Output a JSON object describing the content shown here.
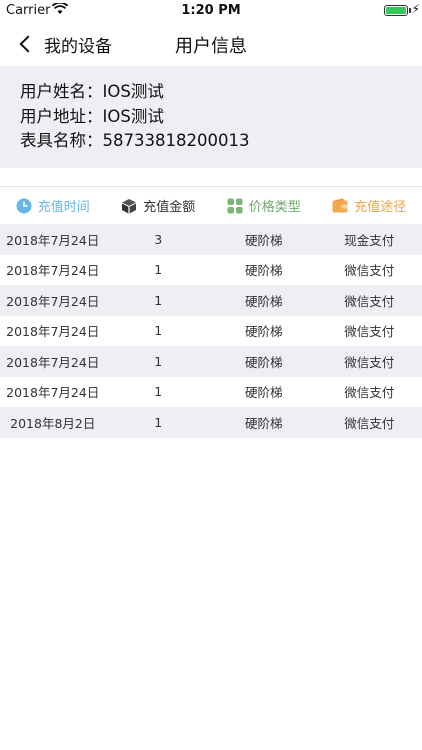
{
  "status_bar": {
    "carrier": "Carrier",
    "time": "1:20 PM"
  },
  "nav": {
    "back_label": "我的设备",
    "title": "用户信息"
  },
  "user_info": {
    "name_label": "用户姓名：",
    "name_value": "IOS测试",
    "address_label": "用户地址：",
    "address_value": "IOS测试",
    "meter_label": "表具名称：",
    "meter_value": "58733818200013"
  },
  "table": {
    "headers": [
      {
        "label": "充值时间",
        "icon": "clock-icon",
        "color": "#67b7ee"
      },
      {
        "label": "充值金额",
        "icon": "box-icon",
        "color": "#333333"
      },
      {
        "label": "价格类型",
        "icon": "grid-icon",
        "color": "#6fa66b"
      },
      {
        "label": "充值途径",
        "icon": "wallet-icon",
        "color": "#f0a44a"
      }
    ],
    "rows": [
      {
        "time": "2018年7月24日",
        "amount": "3",
        "price_type": "硬阶梯",
        "channel": "现金支付"
      },
      {
        "time": "2018年7月24日",
        "amount": "1",
        "price_type": "硬阶梯",
        "channel": "微信支付"
      },
      {
        "time": "2018年7月24日",
        "amount": "1",
        "price_type": "硬阶梯",
        "channel": "微信支付"
      },
      {
        "time": "2018年7月24日",
        "amount": "1",
        "price_type": "硬阶梯",
        "channel": "微信支付"
      },
      {
        "time": "2018年7月24日",
        "amount": "1",
        "price_type": "硬阶梯",
        "channel": "微信支付"
      },
      {
        "time": "2018年7月24日",
        "amount": "1",
        "price_type": "硬阶梯",
        "channel": "微信支付"
      },
      {
        "time": "2018年8月2日",
        "amount": "1",
        "price_type": "硬阶梯",
        "channel": "微信支付"
      }
    ]
  }
}
